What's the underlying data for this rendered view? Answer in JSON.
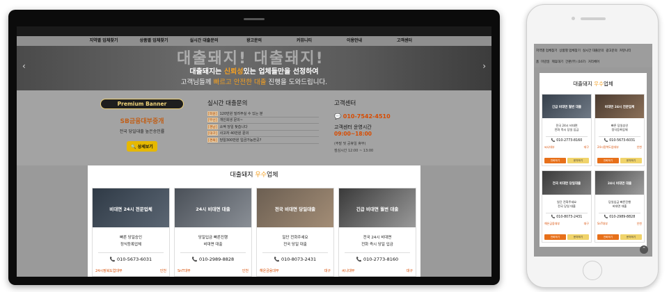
{
  "nav": [
    "지역별 업체찾기",
    "상품별 업체찾기",
    "실시간 대출문의",
    "광고문의",
    "커뮤니티",
    "이용안내",
    "고객센터"
  ],
  "hero": {
    "bg_text": "대출돼지! 대출돼지!",
    "line1_pre": "대출돼지는 ",
    "line1_hl": "신뢰성",
    "line1_post": "있는 업체들만을 선정하여",
    "line2_pre": "고객님들께 ",
    "line2_hl": "빠르고 안전한 대출",
    "line2_post": " 진행을 도와드립니다."
  },
  "premium": {
    "banner": "Premium Banner",
    "title": "SB금융대부중개",
    "desc": "전국 당일대출 높은승인률",
    "button": "상세보기"
  },
  "live": {
    "title": "실시간 대출문의",
    "rows": [
      {
        "tag": "[회원]",
        "text": "120만원 빌려주실 수 있는 분"
      },
      {
        "tag": "[무선]",
        "text": "개인회생 문의~"
      },
      {
        "tag": "[경남]",
        "text": "소액 당일 찾습니다"
      },
      {
        "tag": "[대구]",
        "text": "사고자 40만원 문의"
      },
      {
        "tag": "[경북]",
        "text": "당일300만원 입금가능한곳?"
      }
    ]
  },
  "cs": {
    "title": "고객센터",
    "phone": "010-7542-4510",
    "hours_label": "고객센터 운영시간",
    "hours": "09:00~18:00",
    "note": "(주말 및 공휴일 휴무)",
    "lunch": "점심시간 12:00 ~ 13:00"
  },
  "best": {
    "title_pre": "대출돼지 ",
    "title_hl": "우수",
    "title_post": "업체",
    "cards": [
      {
        "img_title": "비대면 24시 전문업체",
        "desc1": "빠른 당일승인",
        "desc2": "정식등록업체",
        "phone": "010-5673-6031",
        "company": "24시정북도업대부",
        "region": "인천"
      },
      {
        "img_title": "24시 비대면 대출",
        "desc1": "당일입금 빠른진행",
        "desc2": "비대면 대출",
        "phone": "010-2989-8828",
        "company": "SnT대부",
        "region": "인천"
      },
      {
        "img_title": "전국 비대면 당일대출",
        "desc1": "일단 전화주세요",
        "desc2": "전국 당일 대출",
        "phone": "010-8073-2431",
        "company": "해온금융대부",
        "region": "대구"
      },
      {
        "img_title": "긴급 비대면 월변 대출",
        "desc1": "전국 24시 비대면",
        "desc2": "전화 즉시 당일 입금",
        "phone": "010-2773-8160",
        "company": "씨니대부",
        "region": "대구"
      }
    ]
  },
  "phone": {
    "nav_row1": [
      "지역별 업체찾기",
      "상품별 업체찾기",
      "실시간 대출문의",
      "광고문의",
      "커뮤니티"
    ],
    "nav_row2": [
      "홈",
      "마감일",
      "제휴대기",
      "간판(부) (167)",
      "거리체어"
    ],
    "best_title_pre": "대출돼지 ",
    "best_title_hl": "우수",
    "best_title_post": "업체",
    "call_label": "전화하기",
    "sms_label": "문자하기",
    "cards": [
      {
        "img_title": "긴급 비대면 월변 대출",
        "desc1": "전국 24시 비대면",
        "desc2": "전화 즉시 당일 입금",
        "phone": "010-2773-8160",
        "company": "씨니대부",
        "region": "대구"
      },
      {
        "img_title": "비대면 24시 전문업체",
        "desc1": "빠른 당일승인",
        "desc2": "정식등록업체",
        "phone": "010-5673-6031",
        "company": "24시정북도업대부",
        "region": "인천"
      },
      {
        "img_title": "전국 비대면 당일대출",
        "desc1": "일단 전화주세요",
        "desc2": "전국 당일 대출",
        "phone": "010-8073-2431",
        "company": "해온금융대부",
        "region": "대구"
      },
      {
        "img_title": "24시 비대면 대출",
        "desc1": "당일입금 빠른진행",
        "desc2": "비대면 대출",
        "phone": "010-2989-8828",
        "company": "SnT대부",
        "region": "인천"
      }
    ]
  },
  "colors": {
    "accent": "#f4a022",
    "orange_text": "#d84b00",
    "button_yellow": "#e6b800"
  }
}
